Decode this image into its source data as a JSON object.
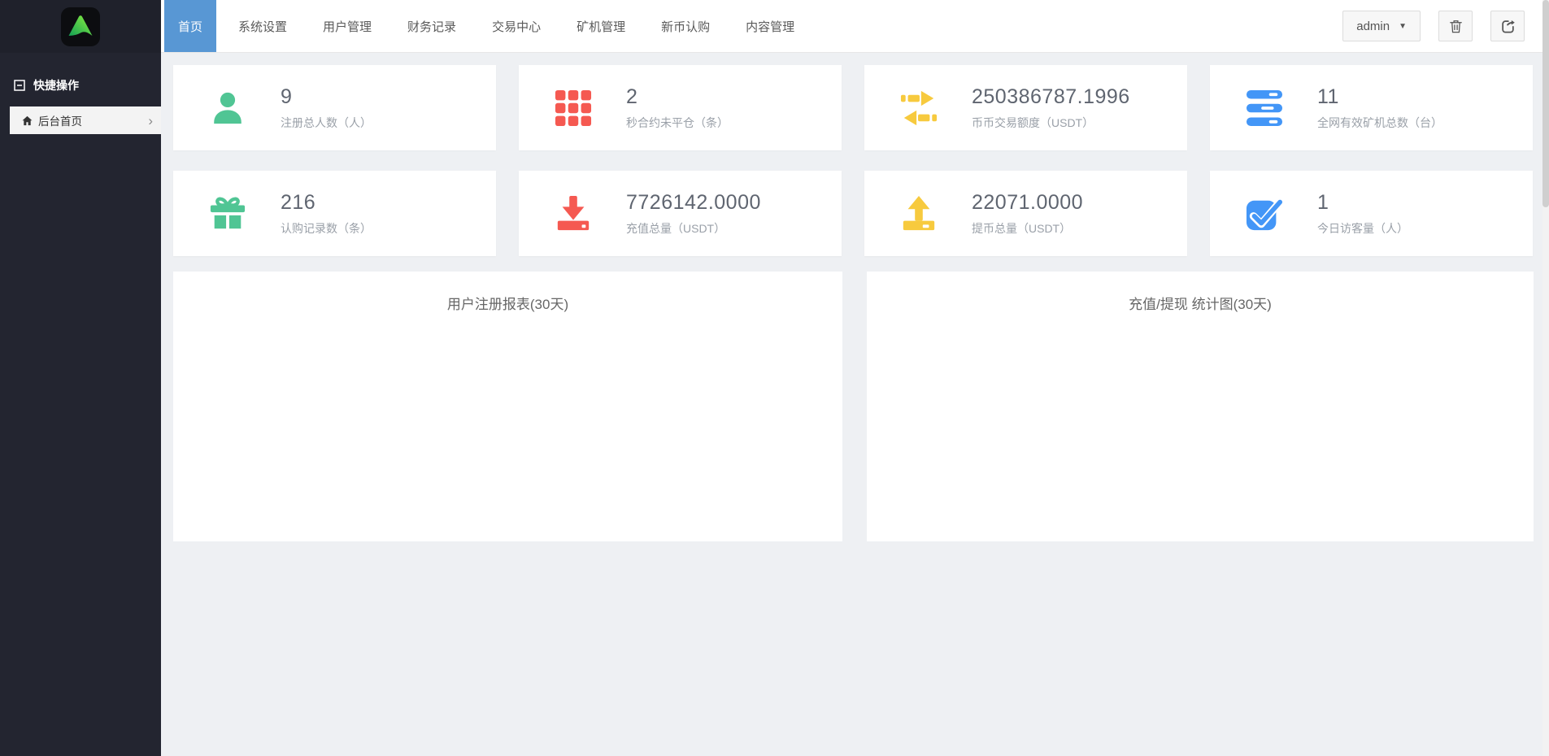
{
  "colors": {
    "accent_blue": "#5897d4",
    "stat_green": "#50c594",
    "stat_red": "#f55951",
    "stat_yellow": "#f7ca3e",
    "stat_blue": "#4396f7",
    "sidebar_bg": "#232530",
    "content_bg": "#eef0f3"
  },
  "icons": {
    "caret_down": "▼",
    "chevron_right": "›"
  },
  "sidebar": {
    "section_title": "快捷操作",
    "items": [
      {
        "label": "后台首页"
      }
    ]
  },
  "navbar": {
    "tabs": [
      {
        "label": "首页",
        "active": true
      },
      {
        "label": "系统设置",
        "active": false
      },
      {
        "label": "用户管理",
        "active": false
      },
      {
        "label": "财务记录",
        "active": false
      },
      {
        "label": "交易中心",
        "active": false
      },
      {
        "label": "矿机管理",
        "active": false
      },
      {
        "label": "新币认购",
        "active": false
      },
      {
        "label": "内容管理",
        "active": false
      }
    ],
    "user_menu_label": "admin"
  },
  "stats": [
    {
      "value": "9",
      "label": "注册总人数（人）",
      "icon": "user-icon",
      "color": "#50c594"
    },
    {
      "value": "2",
      "label": "秒合约未平仓（条）",
      "icon": "grid-icon",
      "color": "#f55951"
    },
    {
      "value": "250386787.1996",
      "label": "币币交易额度（USDT）",
      "icon": "exchange-arrows-icon",
      "color": "#f7ca3e"
    },
    {
      "value": "11",
      "label": "全网有效矿机总数（台）",
      "icon": "server-icon",
      "color": "#4396f7"
    },
    {
      "value": "216",
      "label": "认购记录数（条）",
      "icon": "gift-icon",
      "color": "#50c594"
    },
    {
      "value": "7726142.0000",
      "label": "充值总量（USDT）",
      "icon": "download-icon",
      "color": "#f55951"
    },
    {
      "value": "22071.0000",
      "label": "提币总量（USDT）",
      "icon": "upload-icon",
      "color": "#f7ca3e"
    },
    {
      "value": "1",
      "label": "今日访客量（人）",
      "icon": "check-square-icon",
      "color": "#4396f7"
    }
  ],
  "panels": [
    {
      "title": "用户注册报表(30天)"
    },
    {
      "title": "充值/提现 统计图(30天)"
    }
  ]
}
